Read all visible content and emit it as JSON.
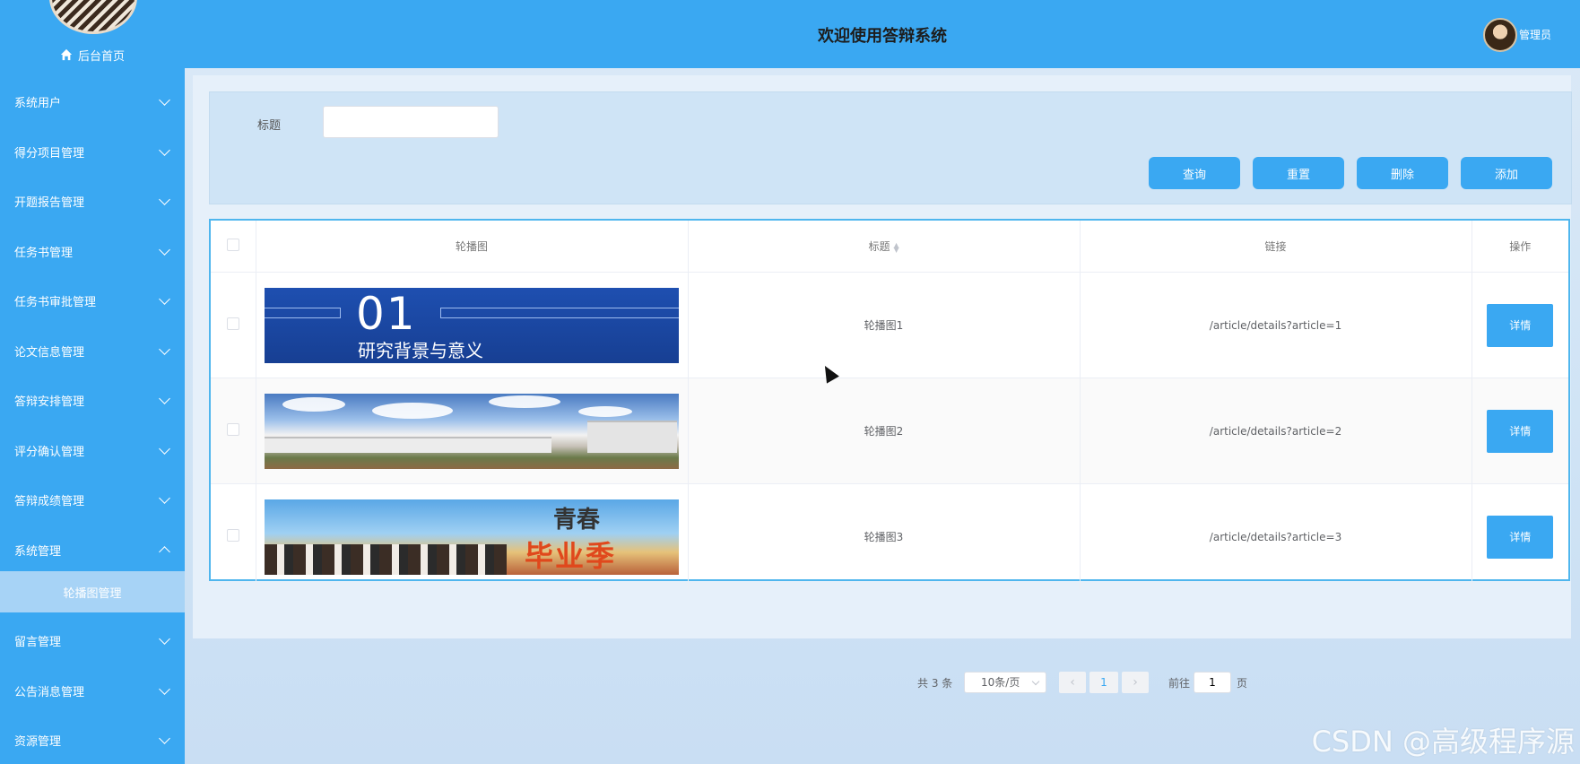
{
  "sidebar": {
    "home_label": "后台首页",
    "items": [
      {
        "label": "系统用户"
      },
      {
        "label": "得分项目管理"
      },
      {
        "label": "开题报告管理"
      },
      {
        "label": "任务书管理"
      },
      {
        "label": "任务书审批管理"
      },
      {
        "label": "论文信息管理"
      },
      {
        "label": "答辩安排管理"
      },
      {
        "label": "评分确认管理"
      },
      {
        "label": "答辩成绩管理"
      },
      {
        "label": "系统管理",
        "expanded": true
      },
      {
        "label": "留言管理"
      },
      {
        "label": "公告消息管理"
      },
      {
        "label": "资源管理"
      }
    ],
    "active_submenu": "轮播图管理"
  },
  "header": {
    "title": "欢迎使用答辩系统",
    "user_name": "管理员"
  },
  "search": {
    "label": "标题",
    "value": "",
    "buttons": {
      "query": "查询",
      "reset": "重置",
      "delete": "删除",
      "add": "添加"
    }
  },
  "table": {
    "columns": [
      "轮播图",
      "标题",
      "链接",
      "操作"
    ],
    "rows": [
      {
        "title": "轮播图1",
        "link": "/article/details?article=1",
        "action": "详情",
        "banner_num": "01",
        "banner_sub": "研究背景与意义"
      },
      {
        "title": "轮播图2",
        "link": "/article/details?article=2",
        "action": "详情"
      },
      {
        "title": "轮播图3",
        "link": "/article/details?article=3",
        "action": "详情",
        "banner_t1": "青春",
        "banner_t2": "毕业季"
      }
    ]
  },
  "pagination": {
    "total": "共 3 条",
    "page_size": "10条/页",
    "prev": "‹",
    "current_page": "1",
    "next": "›",
    "goto_label": "前往",
    "goto_value": "1",
    "page_suffix": "页"
  },
  "watermark": "CSDN @高级程序源",
  "colors": {
    "primary": "#3aa8f2",
    "submenu": "#a7d3f6"
  }
}
